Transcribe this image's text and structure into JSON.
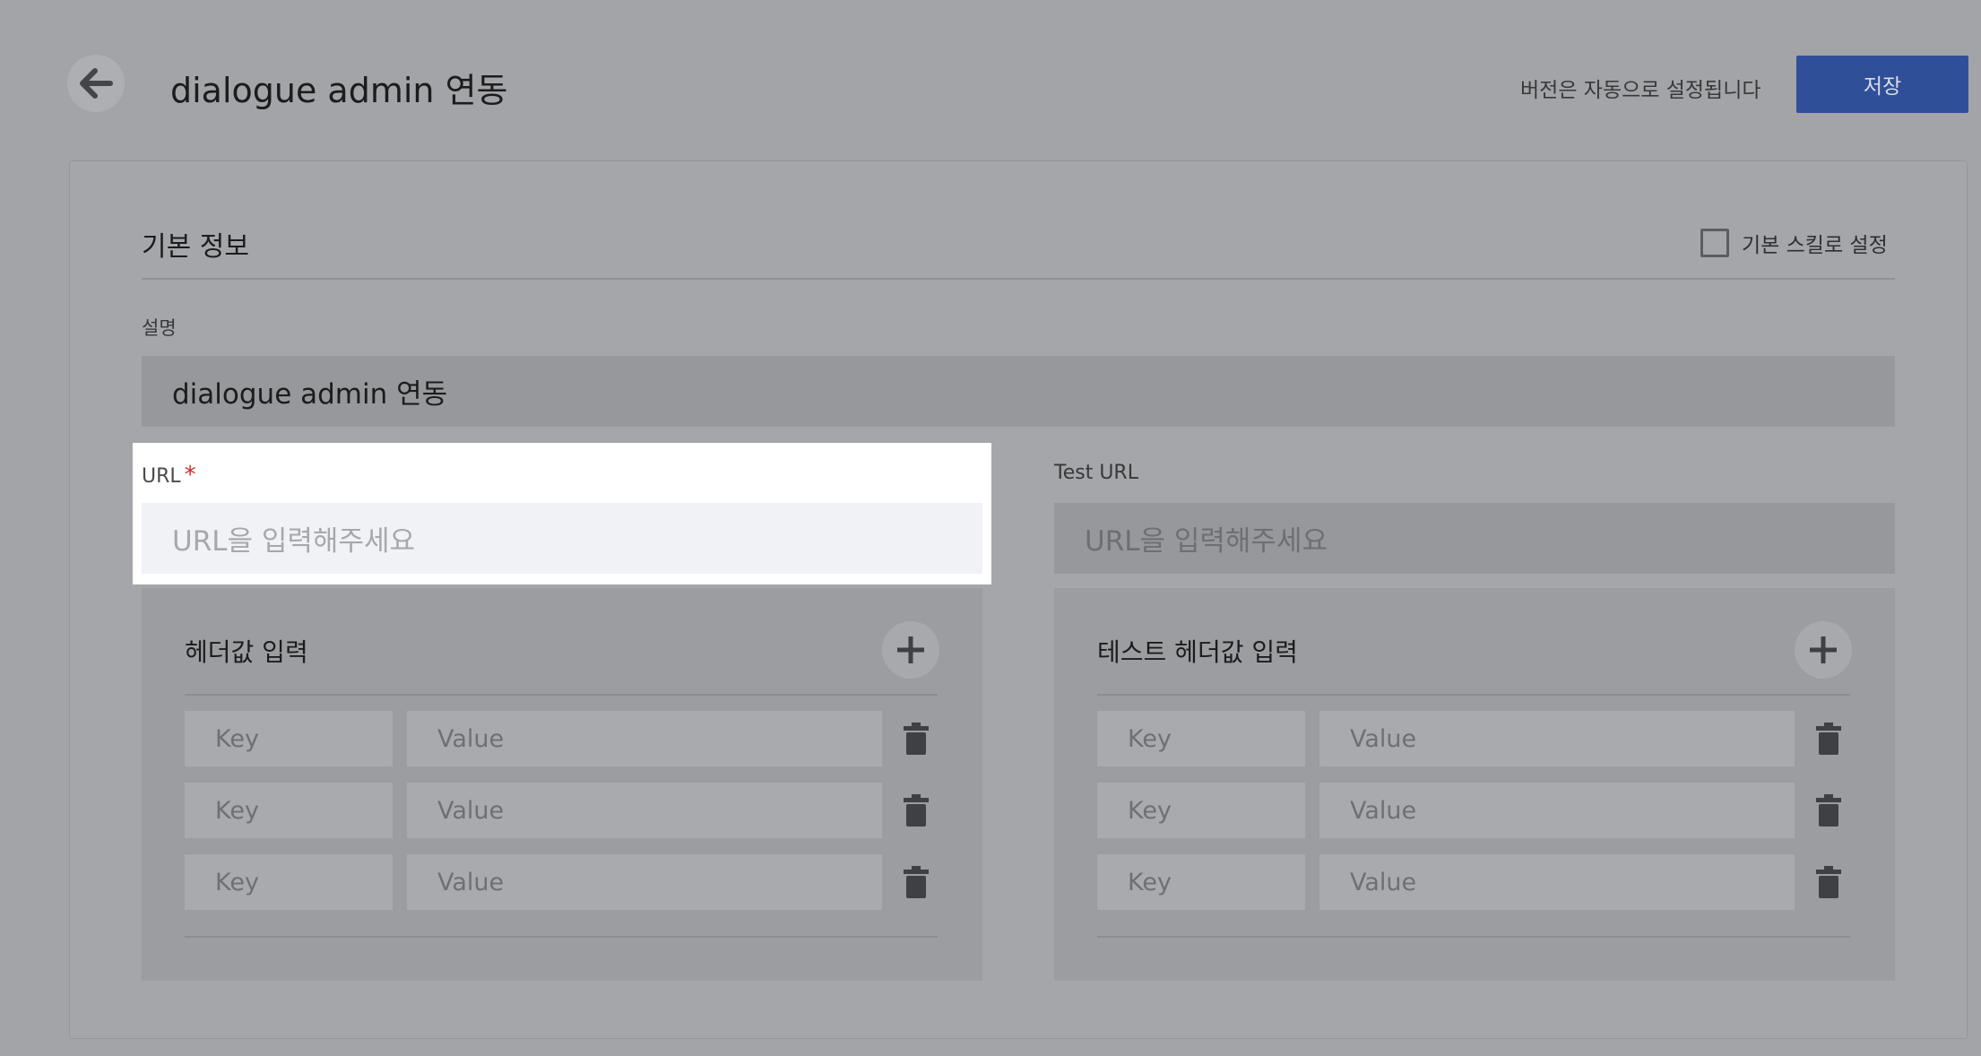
{
  "header": {
    "title": "dialogue admin 연동",
    "version_note": "버전은 자동으로 설정됩니다",
    "save_label": "저장"
  },
  "basic_info": {
    "section_title": "기본 정보",
    "default_skill_label": "기본 스킬로 설정",
    "default_skill_checked": false,
    "description_label": "설명",
    "description_value": "dialogue admin 연동"
  },
  "url": {
    "label": "URL",
    "required_mark": "*",
    "placeholder": "URL을 입력해주세요"
  },
  "test_url": {
    "label": "Test URL",
    "placeholder": "URL을 입력해주세요"
  },
  "headers_panel": {
    "title": "헤더값 입력",
    "rows": [
      {
        "key_placeholder": "Key",
        "value_placeholder": "Value"
      },
      {
        "key_placeholder": "Key",
        "value_placeholder": "Value"
      },
      {
        "key_placeholder": "Key",
        "value_placeholder": "Value"
      }
    ]
  },
  "test_headers_panel": {
    "title": "테스트 헤더값 입력",
    "rows": [
      {
        "key_placeholder": "Key",
        "value_placeholder": "Value"
      },
      {
        "key_placeholder": "Key",
        "value_placeholder": "Value"
      },
      {
        "key_placeholder": "Key",
        "value_placeholder": "Value"
      }
    ]
  },
  "icons": {
    "back": "arrow-left-icon",
    "add": "plus-icon",
    "delete": "trash-icon"
  },
  "colors": {
    "primary": "#2f4f99",
    "required": "#d42a2a"
  }
}
